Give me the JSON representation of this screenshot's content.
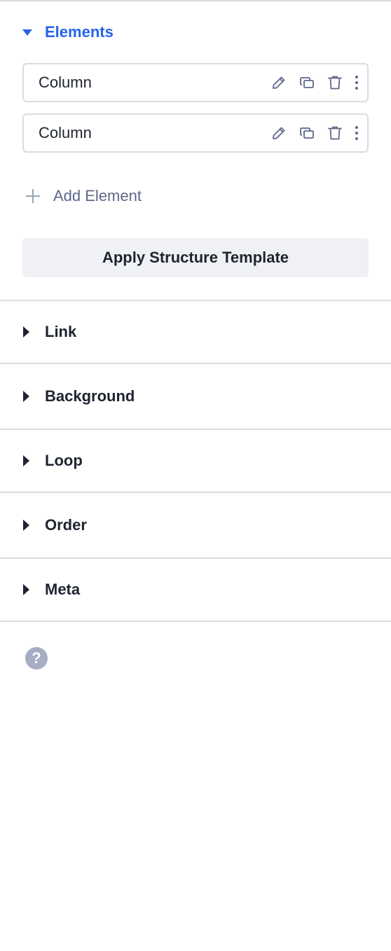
{
  "elements": {
    "title": "Elements",
    "items": [
      {
        "label": "Column"
      },
      {
        "label": "Column"
      }
    ],
    "add_label": "Add Element",
    "apply_label": "Apply Structure Template"
  },
  "sections": [
    {
      "label": "Link"
    },
    {
      "label": "Background"
    },
    {
      "label": "Loop"
    },
    {
      "label": "Order"
    },
    {
      "label": "Meta"
    }
  ],
  "help": {
    "glyph": "?"
  },
  "colors": {
    "accent": "#2563eb",
    "divider": "#d9dce2",
    "text": "#1e2430",
    "muted": "#5d6787",
    "button_bg": "#eff1f4",
    "help_bg": "#a6adc4"
  },
  "icons": [
    "caret-down-icon",
    "pencil-icon",
    "duplicate-icon",
    "trash-icon",
    "more-vertical-icon",
    "plus-icon",
    "caret-right-icon",
    "help-icon"
  ]
}
